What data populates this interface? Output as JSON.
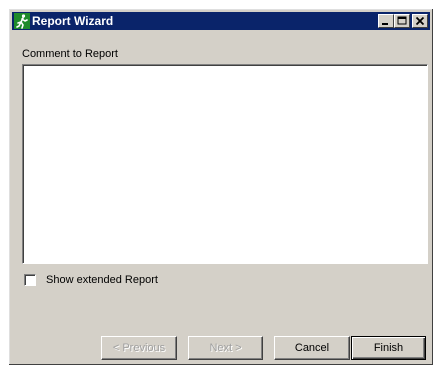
{
  "window": {
    "title": "Report Wizard",
    "icon": "running-man-icon",
    "controls": {
      "minimize_icon": "minimize-icon",
      "maximize_icon": "maximize-icon",
      "close_icon": "close-icon"
    },
    "titlebar_color": "#0a246a",
    "face_color": "#d4d0c8"
  },
  "comment": {
    "label": "Comment to Report",
    "value": ""
  },
  "options": {
    "show_extended_label": "Show extended Report",
    "show_extended_checked": false
  },
  "buttons": {
    "previous_label": "< Previous",
    "previous_enabled": false,
    "next_label": "Next >",
    "next_enabled": false,
    "cancel_label": "Cancel",
    "finish_label": "Finish"
  }
}
